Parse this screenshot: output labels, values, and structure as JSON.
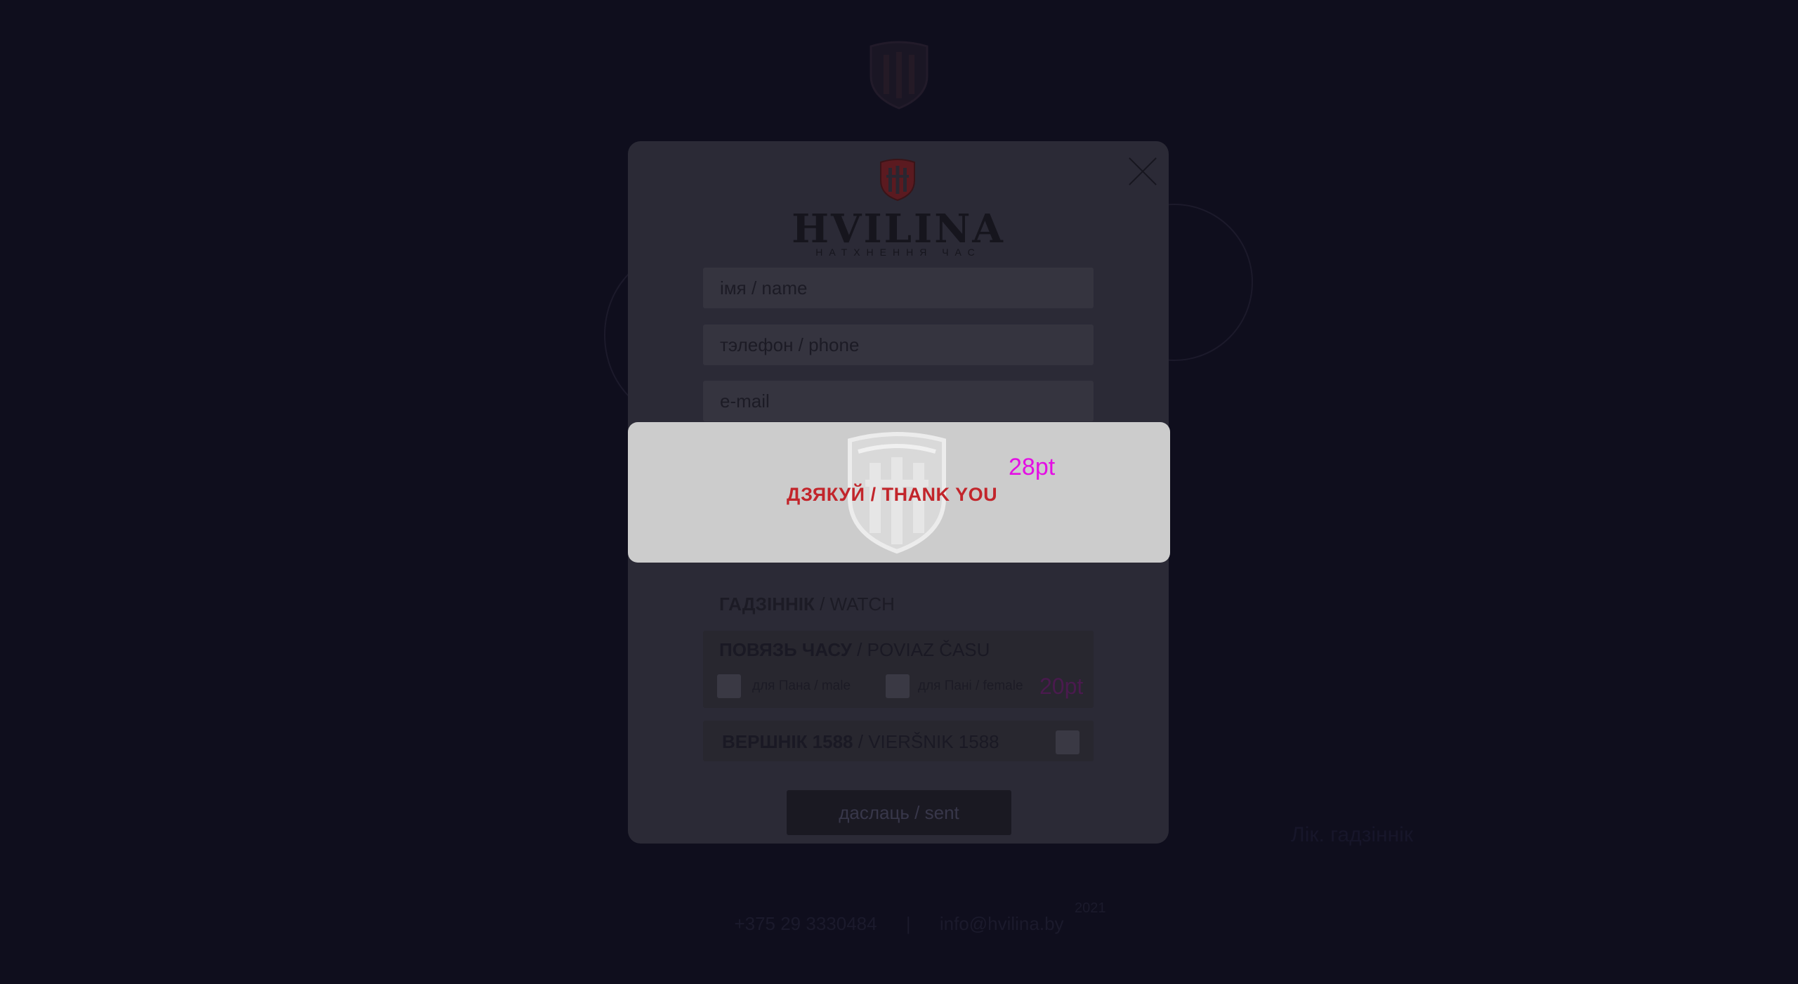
{
  "background": {
    "watch_label": "Лік. гадзіннік",
    "footer": {
      "phone": "+375 29 3330484",
      "separator": "|",
      "email": "info@hvilina.by",
      "mark": "2021"
    }
  },
  "modal": {
    "brand": {
      "name": "HVILINA",
      "tagline": "НАТХНЕННЯ ЧАС"
    },
    "fields": {
      "name_placeholder": "імя / name",
      "phone_placeholder": "тэлефон / phone",
      "email_placeholder": "e-mail",
      "comment_placeholder": ""
    },
    "watch_section": {
      "label_bold": "ГАДЗІННІК",
      "label_rest": " / WATCH"
    },
    "strap_group": {
      "title_bold": "ПОВЯЗЬ ЧАСУ",
      "title_rest": " / POVIAZ ČASU",
      "option_male": "для Пана / male",
      "option_female": "для Пані / female",
      "size_hint": "20pt"
    },
    "top_group": {
      "title_bold": "ВЕРШНІК 1588",
      "title_rest": " / VIERŠNIK 1588"
    },
    "send_label": "даслаць / sent"
  },
  "thanks_popup": {
    "message": "ДЗЯКУЙ / THANK YOU",
    "size_hint": "28pt"
  },
  "colors": {
    "page_bg": "#0f0e1d",
    "modal_bg": "#2b2a36",
    "popup_bg": "#cccccc",
    "accent_red": "#c2252b",
    "hint_magenta": "#e40ee4"
  }
}
